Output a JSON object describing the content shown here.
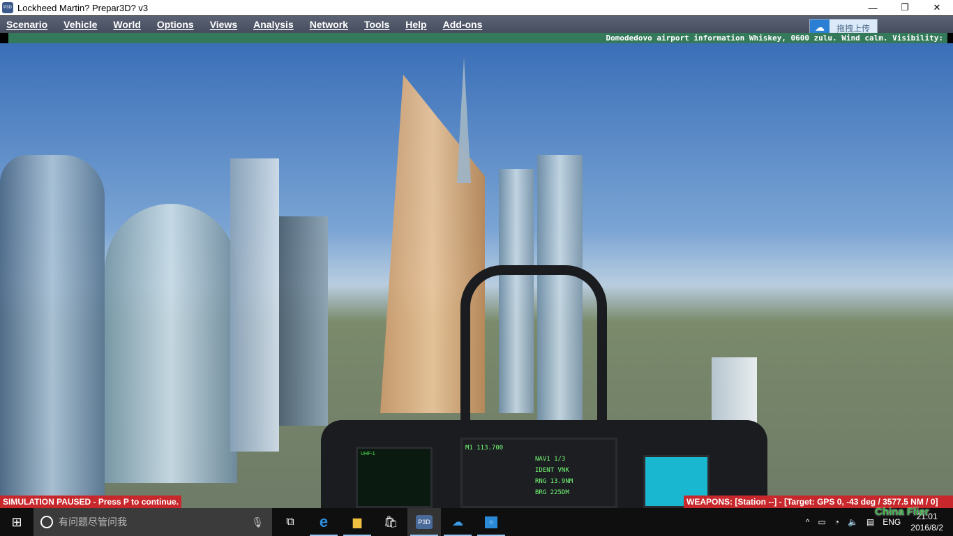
{
  "window": {
    "title": "Lockheed Martin? Prepar3D? v3",
    "app_icon": "P3D",
    "minimize": "—",
    "maximize": "❐",
    "close": "✕"
  },
  "menu": [
    {
      "label": "Scenario"
    },
    {
      "label": "Vehicle"
    },
    {
      "label": "World"
    },
    {
      "label": "Options"
    },
    {
      "label": "Views"
    },
    {
      "label": "Analysis"
    },
    {
      "label": "Network"
    },
    {
      "label": "Tools"
    },
    {
      "label": "Help"
    },
    {
      "label": "Add-ons"
    }
  ],
  "upload_widget": {
    "label": "拖拽上传",
    "icon": "cloud-upload-icon"
  },
  "atis": "Domodedovo airport information Whiskey, 0600 zulu. Wind calm. Visibility:",
  "status": {
    "paused": "SIMULATION PAUSED - Press P to continue.",
    "weapons": "WEAPONS: [Station --] - [Target: GPS 0, -43 deg / 3577.5 NM / 0]"
  },
  "cockpit": {
    "ufc_freq": "M1 113.700",
    "nav": "NAV1 1/3",
    "ident": "IDENT VNK",
    "rng": "RNG 13.9NM",
    "brg": "BRG 225DM"
  },
  "taskbar": {
    "search_placeholder": "有问题尽管问我",
    "p3d_label": "P3D",
    "lang": "ENG",
    "time": "21:01",
    "date": "2016/8/2"
  },
  "watermark": "China Flier",
  "colors": {
    "menu_bg": "#4e5566",
    "atis_bg": "#347a5a",
    "status_red": "#c8282c",
    "taskbar": "#0f0f10"
  }
}
